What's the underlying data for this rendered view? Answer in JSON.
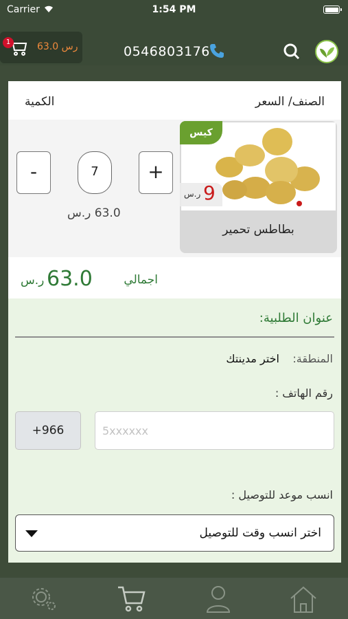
{
  "status_bar": {
    "carrier": "Carrier",
    "time": "1:54 PM"
  },
  "header": {
    "cart_amount": "63.0 رس",
    "cart_badge": "1",
    "phone": "0546803176"
  },
  "table_headers": {
    "price": "الصنف/ السعر",
    "quantity": "الكمية"
  },
  "product": {
    "tag": "كيس",
    "price_value": "9",
    "price_currency": "ر.س",
    "name": "بطاطس تحمير",
    "quantity": "7",
    "line_total": "63.0 ر.س",
    "minus_label": "-",
    "plus_label": "+"
  },
  "total": {
    "label": "اجمالي",
    "value": "63.0",
    "currency": "ر.س"
  },
  "address": {
    "title": "عنوان الطلبية:",
    "region_label": "المنطقة:",
    "region_value": "اختر مدينتك",
    "phone_label": "رقم الهاتف :",
    "country_code": "+966",
    "phone_placeholder": "5xxxxxx",
    "delivery_label": "انسب موعد للتوصيل :",
    "delivery_value": "اختر انسب وقت للتوصيل"
  },
  "tab_bar": {
    "icons": [
      "gear-icon",
      "cart-icon",
      "person-icon",
      "home-icon"
    ]
  },
  "colors": {
    "header_bg": "#3b4a37",
    "accent_green": "#2f7a36",
    "tag_green": "#6aa02f",
    "price_red": "#c91b1b",
    "cart_amount": "#f08a3c"
  }
}
